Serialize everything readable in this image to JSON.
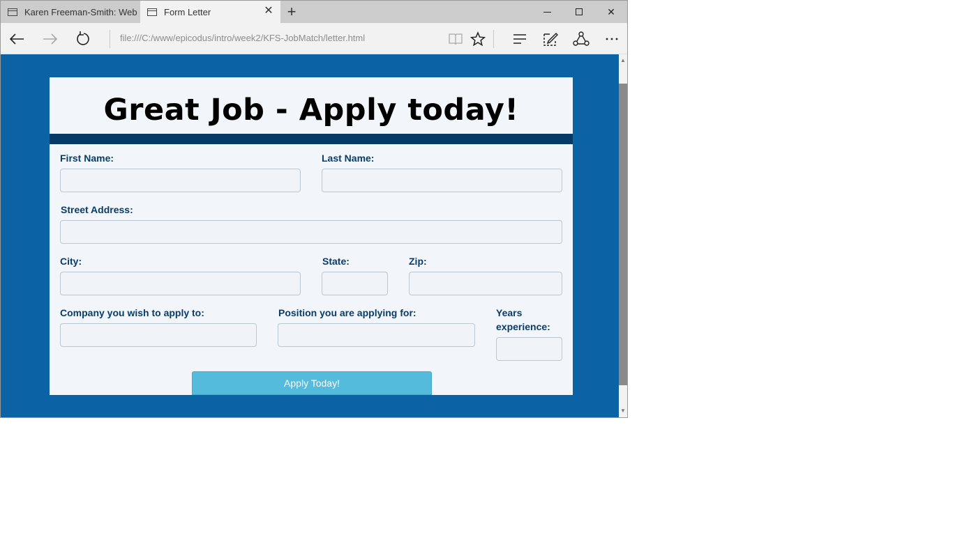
{
  "browser": {
    "tabs": [
      {
        "title": "Karen Freeman-Smith: Web",
        "active": false
      },
      {
        "title": "Form Letter",
        "active": true
      }
    ],
    "url": "file:///C:/www/epicodus/intro/week2/KFS-JobMatch/letter.html",
    "icons": {
      "back": "back-arrow-icon",
      "forward": "forward-arrow-icon",
      "refresh": "refresh-icon",
      "reading_view": "reading-view-icon",
      "favorite": "star-icon",
      "hub": "hub-icon",
      "notes": "web-note-icon",
      "share": "share-icon",
      "more": "more-icon"
    }
  },
  "page": {
    "heading": "Great Job - Apply today!",
    "colors": {
      "background": "#0b63a5",
      "card": "#f2f6fa",
      "rule": "#063a66",
      "label": "#083c6b",
      "button": "#55bbdc"
    },
    "form": {
      "first_name_label": "First Name:",
      "last_name_label": "Last Name:",
      "street_label": "Street Address:",
      "city_label": "City:",
      "state_label": "State:",
      "zip_label": "Zip:",
      "company_label": "Company you wish to apply to:",
      "position_label": "Position you are applying for:",
      "years_label_1": "Years",
      "years_label_2": "experience:",
      "submit_label": "Apply Today!"
    }
  }
}
